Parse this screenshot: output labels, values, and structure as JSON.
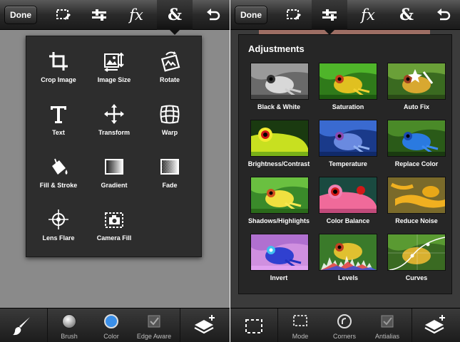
{
  "left": {
    "toolbar": {
      "done_label": "Done",
      "fx_label": "fx",
      "amp_label": "&"
    },
    "tools": [
      {
        "label": "Crop Image",
        "icon": "crop-icon"
      },
      {
        "label": "Image Size",
        "icon": "image-size-icon"
      },
      {
        "label": "Rotate",
        "icon": "rotate-icon"
      },
      {
        "label": "Text",
        "icon": "text-icon"
      },
      {
        "label": "Transform",
        "icon": "transform-icon"
      },
      {
        "label": "Warp",
        "icon": "warp-icon"
      },
      {
        "label": "Fill & Stroke",
        "icon": "fill-stroke-icon"
      },
      {
        "label": "Gradient",
        "icon": "gradient-icon"
      },
      {
        "label": "Fade",
        "icon": "fade-icon"
      },
      {
        "label": "Lens Flare",
        "icon": "lens-flare-icon"
      },
      {
        "label": "Camera Fill",
        "icon": "camera-fill-icon"
      }
    ],
    "bottom": {
      "brush": "Brush",
      "color": "Color",
      "edge_aware": "Edge Aware"
    },
    "colors": {
      "color_swatch": "#3b8fe8"
    }
  },
  "right": {
    "toolbar": {
      "done_label": "Done",
      "fx_label": "fx",
      "amp_label": "&"
    },
    "adjustments_title": "Adjustments",
    "adjustments": [
      {
        "label": "Black & White"
      },
      {
        "label": "Saturation"
      },
      {
        "label": "Auto Fix"
      },
      {
        "label": "Brightness/Contrast"
      },
      {
        "label": "Temperature"
      },
      {
        "label": "Replace Color"
      },
      {
        "label": "Shadows/Highlights"
      },
      {
        "label": "Color Balance"
      },
      {
        "label": "Reduce Noise"
      },
      {
        "label": "Invert"
      },
      {
        "label": "Levels"
      },
      {
        "label": "Curves"
      }
    ],
    "bottom": {
      "mode": "Mode",
      "corners": "Corners",
      "antialias": "Antialias"
    }
  }
}
